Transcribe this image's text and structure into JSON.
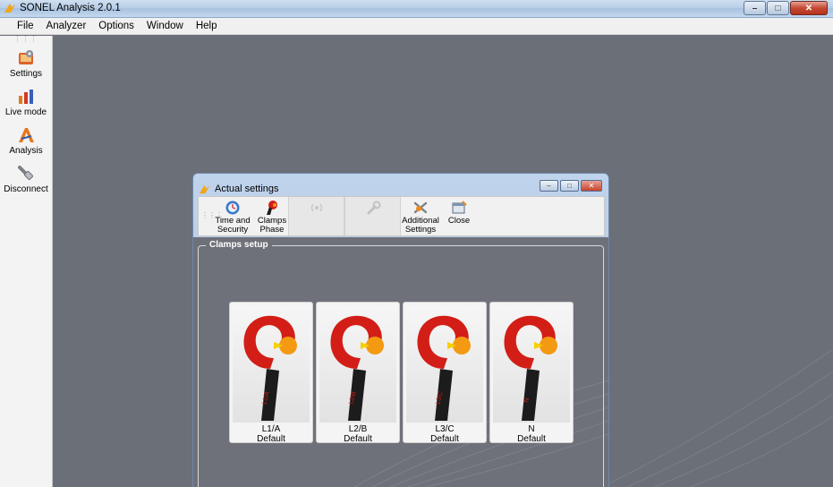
{
  "app": {
    "title": "SONEL Analysis 2.0.1"
  },
  "menu": [
    "File",
    "Analyzer",
    "Options",
    "Window",
    "Help"
  ],
  "sidebar": {
    "items": [
      {
        "label": "Settings",
        "icon": "settings-icon"
      },
      {
        "label": "Live mode",
        "icon": "live-mode-icon"
      },
      {
        "label": "Analysis",
        "icon": "analysis-icon"
      },
      {
        "label": "Disconnect",
        "icon": "disconnect-icon"
      }
    ]
  },
  "dialog": {
    "title": "Actual settings",
    "toolbar": {
      "time_security": [
        "Time and",
        "Security"
      ],
      "clamps_phase": [
        "Clamps",
        "Phase"
      ],
      "additional": [
        "Additional",
        "Settings"
      ],
      "close": "Close"
    },
    "group_title": "Clamps setup",
    "clamps": [
      {
        "name": "L1/A",
        "setting": "Default",
        "marking": "L1/A"
      },
      {
        "name": "L2/B",
        "setting": "Default",
        "marking": "L2/B"
      },
      {
        "name": "L3/C",
        "setting": "Default",
        "marking": "L3/C"
      },
      {
        "name": "N",
        "setting": "Default",
        "marking": "N"
      }
    ]
  },
  "colors": {
    "workspace": "#6b6f78",
    "clamp_red": "#d21e16",
    "clamp_orange": "#f39a12",
    "clamp_black": "#1c1c1c"
  }
}
